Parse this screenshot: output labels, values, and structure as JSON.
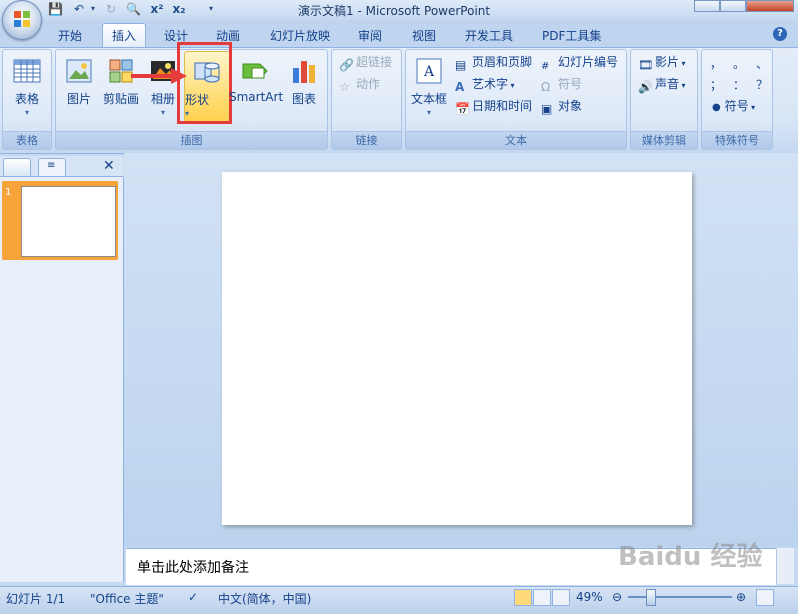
{
  "window": {
    "title": "演示文稿1 - Microsoft PowerPoint"
  },
  "tabs": [
    "开始",
    "插入",
    "设计",
    "动画",
    "幻灯片放映",
    "审阅",
    "视图",
    "开发工具",
    "PDF工具集"
  ],
  "ribbon": {
    "groups": {
      "tables": "表格",
      "illustrations": "插图",
      "links": "链接",
      "text": "文本",
      "media": "媒体剪辑",
      "symbols": "特殊符号"
    },
    "buttons": {
      "table": "表格",
      "picture": "图片",
      "clipart": "剪贴画",
      "album": "相册",
      "shapes": "形状",
      "smartart": "SmartArt",
      "chart": "图表",
      "hyperlink": "超链接",
      "action": "动作",
      "textbox": "文本框",
      "header_footer": "页眉和页脚",
      "wordart": "艺术字",
      "datetime": "日期和时间",
      "slide_number": "幻灯片编号",
      "symbol": "符号",
      "object": "对象",
      "movie": "影片",
      "sound": "声音",
      "special_symbol": "符号"
    },
    "symbol_chars": [
      "，",
      "。",
      "、",
      "；",
      "：",
      "？"
    ]
  },
  "slide_pane": {
    "slide_number": "1"
  },
  "notes": {
    "placeholder": "单击此处添加备注"
  },
  "status_bar": {
    "slide_info": "幻灯片 1/1",
    "theme": "\"Office 主题\"",
    "language": "中文(简体，中国)",
    "zoom": "49%",
    "zoom_fraction": 0.49
  },
  "watermark": "Baidu 经验",
  "colors": {
    "accent": "#15428b",
    "highlight_border": "#e53b3b",
    "selected_thumb": "#f6a33a"
  }
}
